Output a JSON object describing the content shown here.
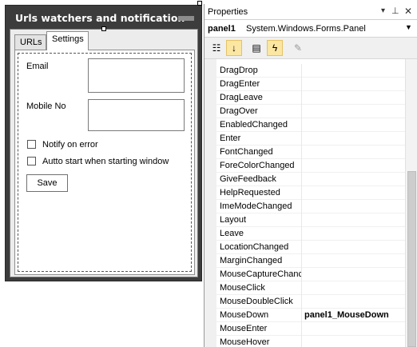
{
  "form": {
    "title": "Urls watchers and notification",
    "tabs": [
      {
        "label": "URLs"
      },
      {
        "label": "Settings"
      }
    ],
    "settings": {
      "email_label": "Email",
      "mobile_label": "Mobile No",
      "notify_label": "Notify on error",
      "autostart_label": "Autto start when starting window",
      "save_label": "Save"
    }
  },
  "properties": {
    "title": "Properties",
    "title_icons": [
      "dropdown-arrow-icon",
      "pin-icon",
      "close-icon"
    ],
    "object_name": "panel1",
    "object_type": "System.Windows.Forms.Panel",
    "toolbar": [
      "categorized-icon",
      "alphabetical-icon",
      "properties-icon",
      "events-icon",
      "property-pages-icon"
    ],
    "events": [
      {
        "name": "DragDrop",
        "value": ""
      },
      {
        "name": "DragEnter",
        "value": ""
      },
      {
        "name": "DragLeave",
        "value": ""
      },
      {
        "name": "DragOver",
        "value": ""
      },
      {
        "name": "EnabledChanged",
        "value": ""
      },
      {
        "name": "Enter",
        "value": ""
      },
      {
        "name": "FontChanged",
        "value": ""
      },
      {
        "name": "ForeColorChanged",
        "value": ""
      },
      {
        "name": "GiveFeedback",
        "value": ""
      },
      {
        "name": "HelpRequested",
        "value": ""
      },
      {
        "name": "ImeModeChanged",
        "value": ""
      },
      {
        "name": "Layout",
        "value": ""
      },
      {
        "name": "Leave",
        "value": ""
      },
      {
        "name": "LocationChanged",
        "value": ""
      },
      {
        "name": "MarginChanged",
        "value": ""
      },
      {
        "name": "MouseCaptureChanc",
        "value": ""
      },
      {
        "name": "MouseClick",
        "value": ""
      },
      {
        "name": "MouseDoubleClick",
        "value": ""
      },
      {
        "name": "MouseDown",
        "value": "panel1_MouseDown"
      },
      {
        "name": "MouseEnter",
        "value": ""
      },
      {
        "name": "MouseHover",
        "value": ""
      }
    ],
    "colors": {
      "active_tool": "#fbe6a2",
      "form_frame": "#3c3c3c"
    }
  }
}
